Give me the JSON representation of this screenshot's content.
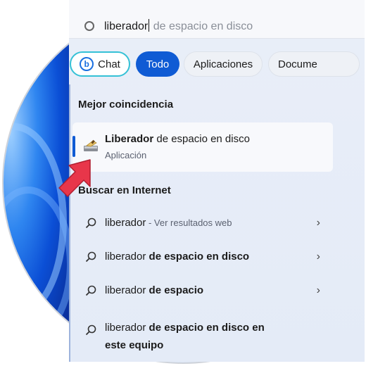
{
  "search": {
    "typed": "liberador",
    "suggestion": " de espacio en disco"
  },
  "filters": {
    "chat": "Chat",
    "todo": "Todo",
    "apps": "Aplicaciones",
    "docs": "Docume"
  },
  "best_match": {
    "section_title": "Mejor coincidencia",
    "name_bold": "Liberador",
    "name_rest": " de espacio en disco",
    "type": "Aplicación"
  },
  "internet": {
    "section_title": "Buscar en Internet",
    "items": [
      {
        "plain": "liberador",
        "bold": "",
        "hint": " - Ver resultados web"
      },
      {
        "plain": "liberador ",
        "bold": "de espacio en disco",
        "hint": ""
      },
      {
        "plain": "liberador ",
        "bold": "de espacio",
        "hint": ""
      },
      {
        "plain": "liberador ",
        "bold": "de espacio en disco en este equipo",
        "hint": ""
      }
    ]
  },
  "colors": {
    "accent": "#0f5bd4",
    "chat_border": "#35c1d6",
    "pointer_arrow": "#e8364a"
  }
}
